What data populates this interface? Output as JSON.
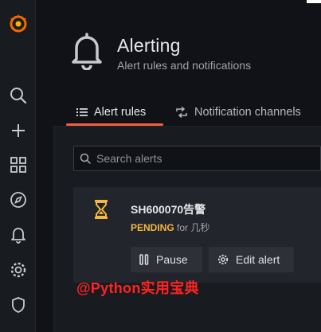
{
  "header": {
    "title": "Alerting",
    "subtitle": "Alert rules and notifications"
  },
  "tabs": [
    {
      "label": "Alert rules",
      "active": true
    },
    {
      "label": "Notification channels",
      "active": false
    }
  ],
  "search": {
    "placeholder": "Search alerts"
  },
  "rule": {
    "name": "SH600070告警",
    "state": "PENDING",
    "for_text": "for 几秒",
    "pause_label": "Pause",
    "edit_label": "Edit alert"
  },
  "watermark": "@Python实用宝典",
  "colors": {
    "accent": "#f55f3e",
    "pending": "#f5b73d",
    "watermark": "#ff2323"
  },
  "sidebar_icons": [
    "grafana-logo-icon",
    "search-icon",
    "plus-icon",
    "dashboards-icon",
    "explore-compass-icon",
    "bell-icon",
    "gear-icon",
    "shield-icon"
  ]
}
